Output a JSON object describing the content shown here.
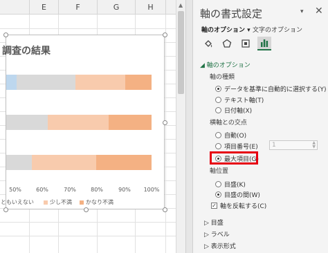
{
  "sheet": {
    "columns": [
      "E",
      "F",
      "G",
      "H"
    ]
  },
  "chart": {
    "title_partial": "調査の結果",
    "chart_data": {
      "type": "bar",
      "orientation": "horizontal-stacked-100",
      "visible_tick_labels": [
        "50%",
        "60%",
        "70%",
        "80%",
        "90%",
        "100%"
      ],
      "legend_visible": [
        "ともいえない",
        "少し不満",
        "かなり不満"
      ],
      "legend_placement": "bottom",
      "colors": [
        "#bdd7ee",
        "#d9d9d9",
        "#f8cbad",
        "#f4b183"
      ]
    }
  },
  "pane": {
    "title": "軸の書式設定",
    "dropdown_icon": "chevron-down-icon",
    "close_icon": "close-icon",
    "tabs": {
      "axis_options": "軸のオプション",
      "text_options": "文字のオプション"
    },
    "icons": [
      "fill-line-icon",
      "effects-pentagon-icon",
      "size-properties-icon",
      "bar-chart-icon"
    ],
    "section_axis_options": "軸のオプション",
    "axis_type": {
      "label": "軸の種類",
      "options": [
        "データを基準に自動的に選択する(Y)",
        "テキスト軸(T)",
        "日付軸(X)"
      ],
      "selected_index": 0
    },
    "crosses": {
      "label": "横軸との交点",
      "options": [
        "自動(O)",
        "項目番号(E)",
        "最大項目(G)"
      ],
      "selected_index": 2,
      "number_value": "1"
    },
    "axis_position": {
      "label": "軸位置",
      "options": [
        "目盛(K)",
        "目盛の間(W)"
      ],
      "selected_index": 1
    },
    "reverse_order": {
      "label": "軸を反転する(C)",
      "checked": true
    },
    "collapsed_sections": [
      "目盛",
      "ラベル",
      "表示形式"
    ],
    "accent_color": "#217346",
    "highlight_color": "#e60012"
  }
}
